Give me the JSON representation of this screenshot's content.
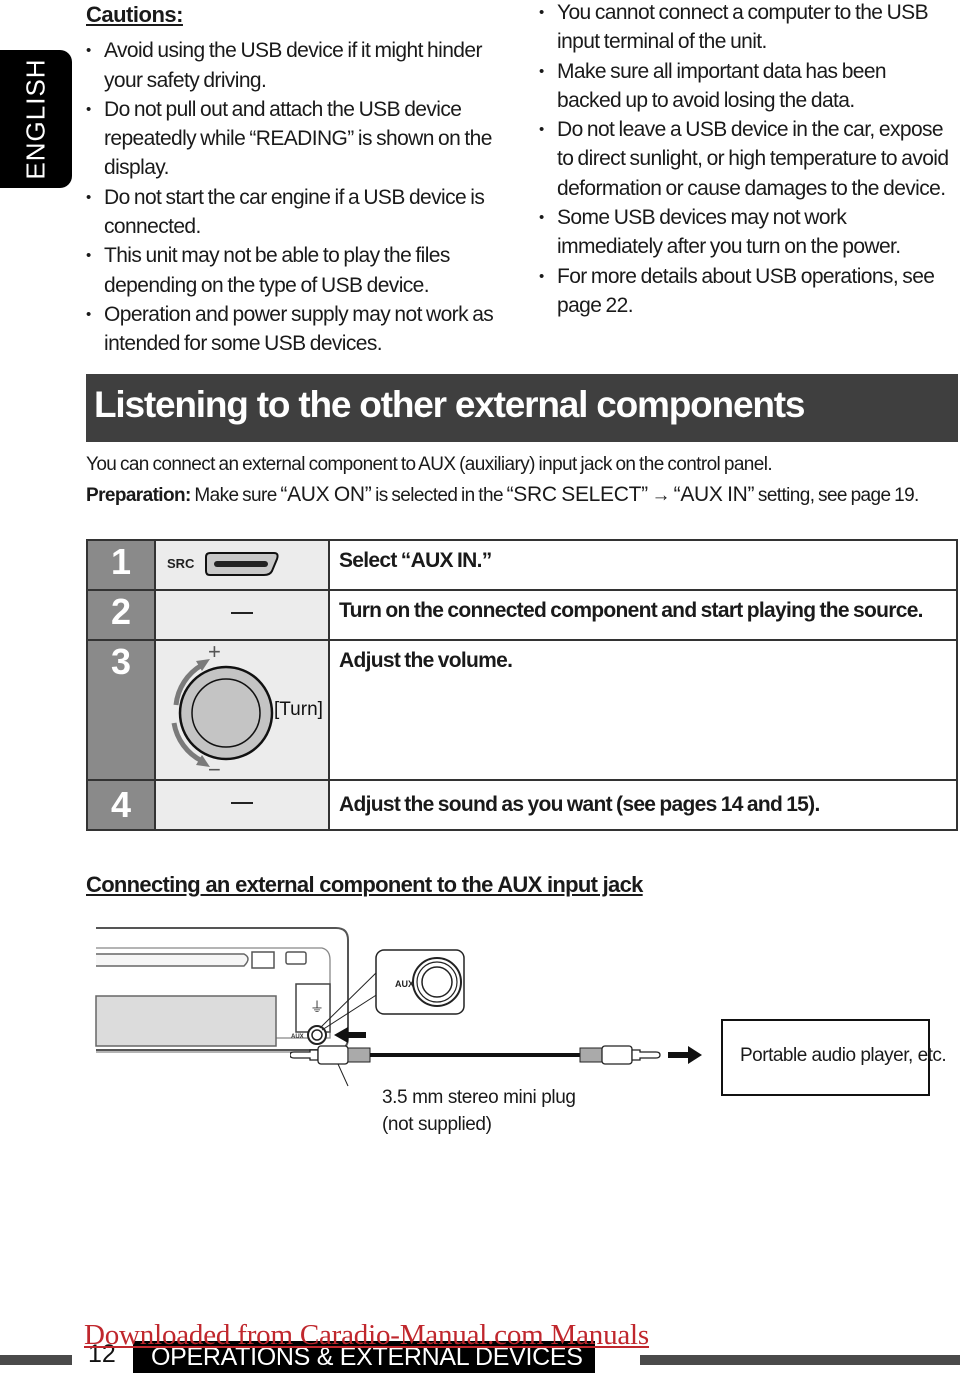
{
  "language_tab": "ENGLISH",
  "cautions": {
    "title": "Cautions:",
    "left_items": [
      "Avoid using the USB device if it might hinder your safety driving.",
      "Do not pull out and attach the USB device repeatedly while “READING” is shown on the display.",
      "Do not start the car engine if a USB device is connected.",
      "This unit may not be able to play the files depending on the type of USB device.",
      "Operation and power supply may not work as intended for some USB devices."
    ],
    "right_items": [
      "You cannot connect a computer to the USB input terminal of the unit.",
      "Make sure all important data has been backed up to avoid losing the data.",
      "Do not leave a USB device in the car, expose to direct sunlight, or high temperature to avoid deformation or cause damages to the device.",
      "Some USB devices may not work immediately after you turn on the power.",
      "For more details about USB operations, see page 22."
    ]
  },
  "section": {
    "title": "Listening to the other external components",
    "intro": "You can connect an external component to AUX (auxiliary) input jack on the control panel.",
    "preparation_label": "Preparation:",
    "preparation_parts": {
      "p1": " Make sure ",
      "aux_on": "“AUX ON”",
      "p2": " is selected in the ",
      "src_select": "“SRC SELECT”",
      "arrow": " → ",
      "aux_in": "“AUX IN”",
      "p3": " setting, see page 19."
    }
  },
  "steps": [
    {
      "number": "1",
      "button_label": "SRC",
      "text": "Select “AUX IN.”"
    },
    {
      "number": "2",
      "text": "Turn on the connected component and start playing the source."
    },
    {
      "number": "3",
      "knob_plus": "+",
      "knob_minus": "−",
      "knob_label": "[Turn]",
      "text": "Adjust the volume."
    },
    {
      "number": "4",
      "text": "Adjust the sound as you want (see pages 14 and 15)."
    }
  ],
  "connection": {
    "title": "Connecting an external component to the AUX input jack",
    "aux_label": "AUX",
    "aux_small_label": "AUX",
    "plug_label_line1": "3.5 mm stereo mini plug",
    "plug_label_line2": "(not supplied)",
    "player_label": "Portable audio player, etc."
  },
  "footer": {
    "page_number": "12",
    "section_title": "OPERATIONS & EXTERNAL DEVICES",
    "watermark": "Downloaded from Caradio-Manual.com Manuals"
  },
  "colors": {
    "banner_bg": "#3f3f3f",
    "step_number_bg": "#8a8a8a",
    "illustration_bg": "#ececec",
    "watermark": "#c0272d"
  }
}
